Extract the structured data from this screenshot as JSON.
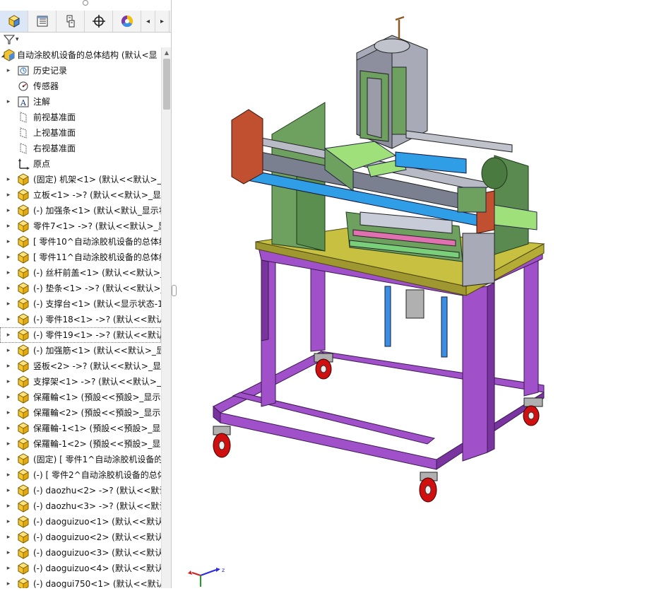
{
  "toolbar": {
    "tabs": [
      {
        "name": "feature-manager-tab",
        "icon": "assembly-icon"
      },
      {
        "name": "property-manager-tab",
        "icon": "property-list-icon"
      },
      {
        "name": "configuration-manager-tab",
        "icon": "configuration-icon"
      },
      {
        "name": "dimxpert-manager-tab",
        "icon": "crosshair-icon"
      },
      {
        "name": "display-manager-tab",
        "icon": "color-wheel-icon"
      }
    ],
    "scroll_left": "◂",
    "scroll_right": "▸"
  },
  "filter": {
    "icon": "filter-icon",
    "dropdown": "▾"
  },
  "tree": {
    "root": "自动涂胶机设备的总体结构  (默认<显",
    "items": [
      {
        "label": "历史记录",
        "icon": "history-icon",
        "expand": true,
        "indent": 1
      },
      {
        "label": "传感器",
        "icon": "sensor-icon",
        "expand": false,
        "indent": 1
      },
      {
        "label": "注解",
        "icon": "annotation-icon",
        "expand": true,
        "indent": 1
      },
      {
        "label": "前视基准面",
        "icon": "plane-icon",
        "expand": false,
        "indent": 1
      },
      {
        "label": "上视基准面",
        "icon": "plane-icon",
        "expand": false,
        "indent": 1
      },
      {
        "label": "右视基准面",
        "icon": "plane-icon",
        "expand": false,
        "indent": 1
      },
      {
        "label": "原点",
        "icon": "origin-icon",
        "expand": false,
        "indent": 1
      },
      {
        "label": "(固定) 机架<1> (默认<<默认>_显",
        "icon": "part-icon",
        "expand": true,
        "indent": 1
      },
      {
        "label": "立板<1> ->? (默认<<默认>_显示",
        "icon": "part-icon",
        "expand": true,
        "indent": 1
      },
      {
        "label": "(-) 加强条<1> (默认<默认_显示状",
        "icon": "part-icon",
        "expand": true,
        "indent": 1
      },
      {
        "label": "零件7<1> ->? (默认<<默认>_显",
        "icon": "part-icon",
        "expand": true,
        "indent": 1
      },
      {
        "label": "[ 零件10^自动涂胶机设备的总体结",
        "icon": "part-icon",
        "expand": true,
        "indent": 1
      },
      {
        "label": "[ 零件11^自动涂胶机设备的总体结",
        "icon": "part-icon",
        "expand": true,
        "indent": 1
      },
      {
        "label": "(-) 丝杆前盖<1> (默认<<默认>_",
        "icon": "part-icon",
        "expand": true,
        "indent": 1
      },
      {
        "label": "(-) 垫条<1> ->? (默认<<默认>_",
        "icon": "part-icon",
        "expand": true,
        "indent": 1
      },
      {
        "label": "(-) 支撑台<1> (默认<显示状态-1",
        "icon": "part-icon",
        "expand": true,
        "indent": 1
      },
      {
        "label": "(-) 零件18<1> ->? (默认<<默认",
        "icon": "part-icon",
        "expand": true,
        "indent": 1
      },
      {
        "label": "(-) 零件19<1> ->? (默认<<默认",
        "icon": "part-icon",
        "expand": true,
        "indent": 1,
        "selected": true
      },
      {
        "label": "(-) 加强筋<1> (默认<<默认>_显",
        "icon": "part-icon",
        "expand": true,
        "indent": 1
      },
      {
        "label": "竖板<2> ->? (默认<<默认>_显示",
        "icon": "part-icon",
        "expand": true,
        "indent": 1
      },
      {
        "label": "支撑架<1> ->? (默认<<默认>_显",
        "icon": "part-icon",
        "expand": true,
        "indent": 1
      },
      {
        "label": "保羅輪<1> (預設<<預設>_显示状",
        "icon": "part-icon",
        "expand": true,
        "indent": 1
      },
      {
        "label": "保羅輪<2> (預設<<預設>_显示状",
        "icon": "part-icon",
        "expand": true,
        "indent": 1
      },
      {
        "label": "保羅輪-1<1> (預設<<預設>_显示",
        "icon": "part-icon",
        "expand": true,
        "indent": 1
      },
      {
        "label": "保羅輪-1<2> (預設<<預設>_显示",
        "icon": "part-icon",
        "expand": true,
        "indent": 1
      },
      {
        "label": "(固定) [ 零件1^自动涂胶机设备的",
        "icon": "part-icon",
        "expand": true,
        "indent": 1
      },
      {
        "label": "(-) [ 零件2^自动涂胶机设备的总体",
        "icon": "part-icon",
        "expand": true,
        "indent": 1
      },
      {
        "label": "(-) daozhu<2> ->? (默认<<默认",
        "icon": "part-icon",
        "expand": true,
        "indent": 1
      },
      {
        "label": "(-) daozhu<3> ->? (默认<<默认",
        "icon": "part-icon",
        "expand": true,
        "indent": 1
      },
      {
        "label": "(-) daoguizuo<1> (默认<<默认",
        "icon": "part-icon",
        "expand": true,
        "indent": 1
      },
      {
        "label": "(-) daoguizuo<2> (默认<<默认",
        "icon": "part-icon",
        "expand": true,
        "indent": 1
      },
      {
        "label": "(-) daoguizuo<3> (默认<<默认",
        "icon": "part-icon",
        "expand": true,
        "indent": 1
      },
      {
        "label": "(-) daoguizuo<4> (默认<<默认",
        "icon": "part-icon",
        "expand": true,
        "indent": 1
      },
      {
        "label": "(-) daogui750<1> (默认<<默认",
        "icon": "part-icon",
        "expand": true,
        "indent": 1
      }
    ]
  },
  "viewport": {
    "model": "automatic-glue-dispensing-machine-3d-model",
    "triad": {
      "x_label": "x",
      "y_label": "y",
      "z_label": "z"
    }
  },
  "colors": {
    "frame": "#a050c8",
    "tabletop": "#c8c040",
    "plate_green": "#6ea060",
    "gantry": "#a8aab8",
    "caster": "#d01010",
    "accent_orange": "#c05030",
    "selection_blue": "#dbe7f6"
  }
}
